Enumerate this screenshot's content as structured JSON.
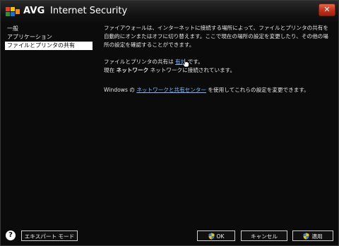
{
  "window": {
    "brand": "AVG",
    "product": "Internet Security",
    "close_label": "✕"
  },
  "nav": {
    "items": [
      {
        "label": "一般"
      },
      {
        "label": "アプリケーション"
      },
      {
        "label": "ファイルとプリンタの共有"
      }
    ]
  },
  "content": {
    "intro": "ファイアウォールは、インターネットに接続する場所によって、ファイルとプリンタの共有を自動的にオンまたはオフに切り替えます。ここで現在の場所の設定を変更したり、その他の場所の設定を確認することができます。",
    "sharing_prefix": "ファイルとプリンタの共有は ",
    "sharing_status": "有効",
    "sharing_suffix": " です。",
    "connection_prefix": "現在 ",
    "connection_network": "ネットワーク",
    "connection_suffix": " ネットワークに接続されています。",
    "windows_prefix": "Windows の ",
    "windows_link": "ネットワークと共有センター",
    "windows_suffix": " を使用してこれらの設定を変更できます。"
  },
  "footer": {
    "help_label": "?",
    "expert_mode": "エキスパート モード",
    "ok": "OK",
    "cancel": "キャンセル",
    "apply": "適用"
  }
}
